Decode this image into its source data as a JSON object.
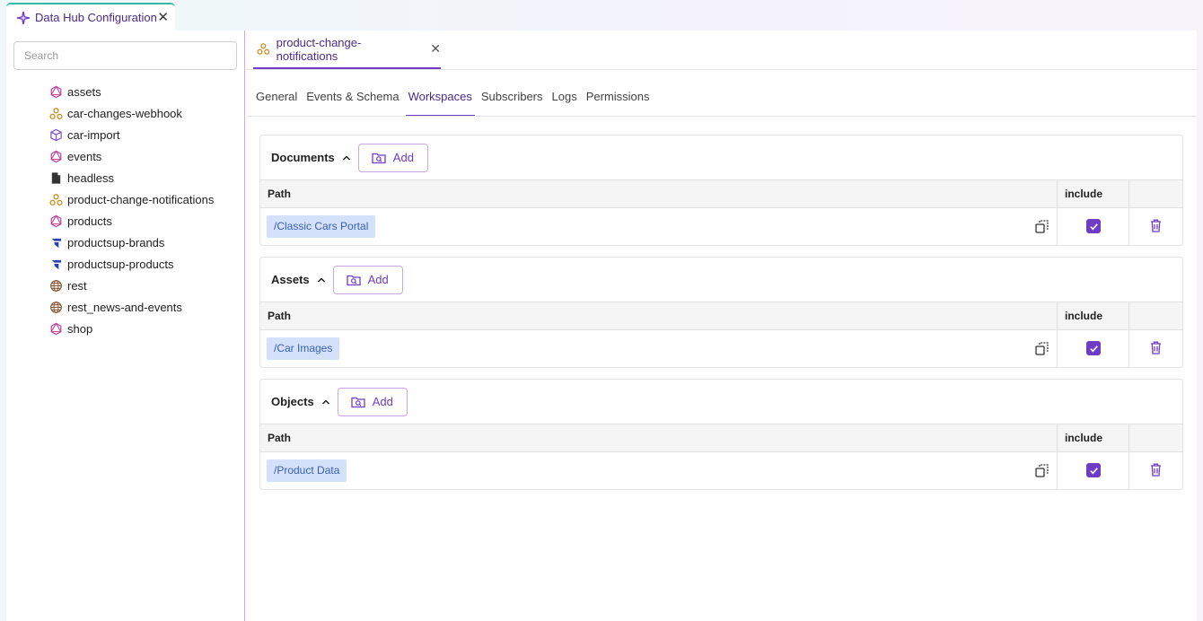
{
  "app": {
    "tab_title": "Data Hub Configuration"
  },
  "sidebar": {
    "search_placeholder": "Search",
    "items": [
      {
        "label": "assets",
        "icon": "graphql-icon"
      },
      {
        "label": "car-changes-webhook",
        "icon": "webhook-icon"
      },
      {
        "label": "car-import",
        "icon": "import-cube-icon"
      },
      {
        "label": "events",
        "icon": "graphql-icon"
      },
      {
        "label": "headless",
        "icon": "document-icon"
      },
      {
        "label": "product-change-notifications",
        "icon": "webhook-icon"
      },
      {
        "label": "products",
        "icon": "graphql-icon"
      },
      {
        "label": "productsup-brands",
        "icon": "productsup-icon"
      },
      {
        "label": "productsup-products",
        "icon": "productsup-icon"
      },
      {
        "label": "rest",
        "icon": "globe-icon"
      },
      {
        "label": "rest_news-and-events",
        "icon": "globe-icon"
      },
      {
        "label": "shop",
        "icon": "graphql-icon"
      }
    ]
  },
  "editor": {
    "tab_label": "product-change-notifications",
    "subtabs": [
      "General",
      "Events & Schema",
      "Workspaces",
      "Subscribers",
      "Logs",
      "Permissions"
    ],
    "active_subtab": "Workspaces",
    "sections": [
      {
        "title": "Documents",
        "add_label": "Add",
        "col_path": "Path",
        "col_include": "include",
        "rows": [
          {
            "path": "/Classic Cars Portal",
            "include": true
          }
        ]
      },
      {
        "title": "Assets",
        "add_label": "Add",
        "col_path": "Path",
        "col_include": "include",
        "rows": [
          {
            "path": "/Car Images",
            "include": true
          }
        ]
      },
      {
        "title": "Objects",
        "add_label": "Add",
        "col_path": "Path",
        "col_include": "include",
        "rows": [
          {
            "path": "/Product Data",
            "include": true
          }
        ]
      }
    ]
  },
  "colors": {
    "accent": "#6f3bc7",
    "chip_bg": "#d4e1fb",
    "chip_text": "#3a5fb0",
    "webhook": "#c98a1e",
    "graphql": "#c03fa0"
  }
}
